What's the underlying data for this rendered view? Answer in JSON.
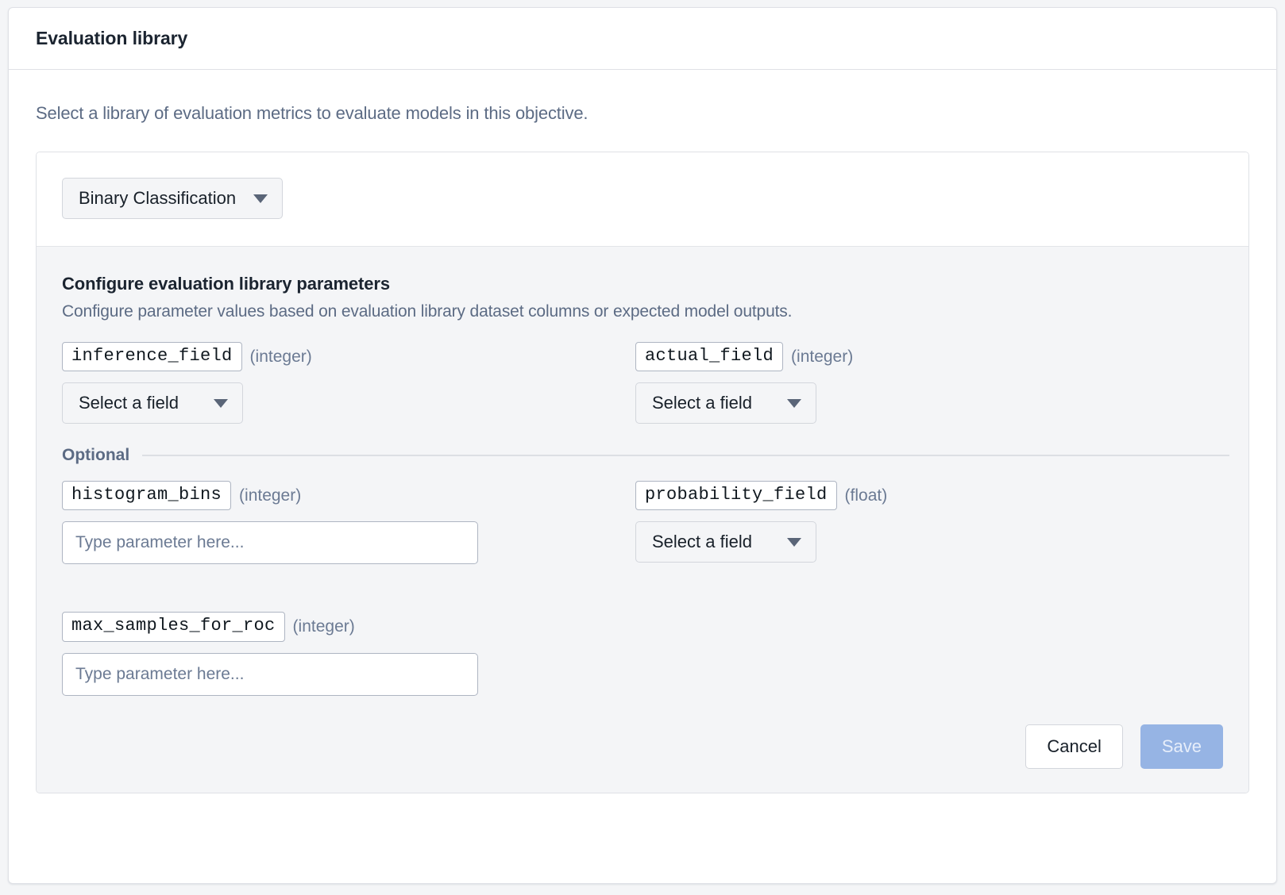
{
  "header": {
    "title": "Evaluation library"
  },
  "intro": {
    "description": "Select a library of evaluation metrics to evaluate models in this objective."
  },
  "library_selector": {
    "selected": "Binary Classification",
    "caret_icon": "chevron-down-icon"
  },
  "params": {
    "title": "Configure evaluation library parameters",
    "subtitle": "Configure parameter values based on evaluation library dataset columns or expected model outputs.",
    "optional_divider_label": "Optional",
    "select_placeholder": "Select a field",
    "input_placeholder": "Type parameter here...",
    "fields": {
      "inference_field": {
        "name": "inference_field",
        "type": "(integer)",
        "control": "select",
        "value": "Select a field"
      },
      "actual_field": {
        "name": "actual_field",
        "type": "(integer)",
        "control": "select",
        "value": "Select a field"
      },
      "histogram_bins": {
        "name": "histogram_bins",
        "type": "(integer)",
        "control": "text",
        "value": "",
        "placeholder": "Type parameter here..."
      },
      "probability_field": {
        "name": "probability_field",
        "type": "(float)",
        "control": "select",
        "value": "Select a field"
      },
      "max_samples_for_roc": {
        "name": "max_samples_for_roc",
        "type": "(integer)",
        "control": "text",
        "value": "",
        "placeholder": "Type parameter here..."
      }
    }
  },
  "actions": {
    "cancel_label": "Cancel",
    "save_label": "Save",
    "save_disabled": true
  },
  "colors": {
    "panel_background": "#f4f5f7",
    "card_background": "#ffffff",
    "border": "#dfe1e6",
    "text_primary": "#1b2430",
    "text_muted": "#5c6b84",
    "save_button": "#96b4e4"
  }
}
